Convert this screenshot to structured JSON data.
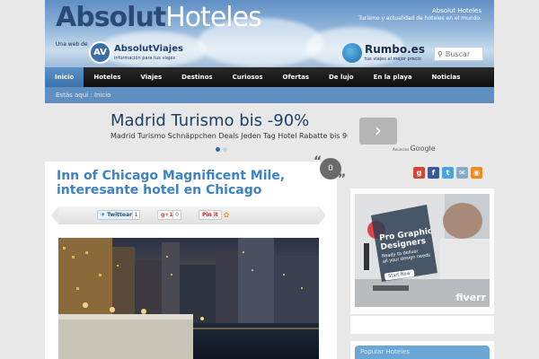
{
  "header": {
    "logo_part1": "Absolut",
    "logo_part2": "Hoteles",
    "una_web": "Una web de",
    "partner_mark": "AV",
    "partner_name": "AbsolutViajes",
    "partner_tagline": "información para tus viajes",
    "site_title": "Absolut Hoteles",
    "site_subtitle": "Turismo y actualidad de hoteles en el mundo.",
    "rumbo_name": "Rumbo.es",
    "rumbo_tagline": "tus viajes al mejor precio",
    "search_placeholder": "Buscar"
  },
  "nav": {
    "items": [
      {
        "label": "Inicio",
        "active": true
      },
      {
        "label": "Hoteles"
      },
      {
        "label": "Viajes"
      },
      {
        "label": "Destinos"
      },
      {
        "label": "Curiosos"
      },
      {
        "label": "Ofertas"
      },
      {
        "label": "De lujo"
      },
      {
        "label": "En la playa"
      },
      {
        "label": "Noticias"
      }
    ]
  },
  "breadcrumb": {
    "text": "Estás aquí : Inicio"
  },
  "ad_banner": {
    "title": "Madrid Turismo bis -90%",
    "text": "Madrid Turismo Schnäppchen Deals Jeden Tag Hotel Rabatte bis 90%!",
    "arrow": "›",
    "google_label": "Anuncios",
    "google_brand": "Google"
  },
  "post": {
    "title": "Inn of Chicago Magnificent Mile, interesante hotel en Chicago",
    "comment_count": "0",
    "quote_open": "“",
    "quote_close": "”",
    "share": {
      "twitter_label": "Twittear",
      "twitter_count": "1",
      "gplus_label": "g+1",
      "gplus_count": "0",
      "pinterest_label": "Pin it",
      "meneame_icon": "meneame-icon"
    }
  },
  "sidebar": {
    "social_icons": [
      {
        "name": "googleplus-icon",
        "glyph": "g",
        "color": "#d34836"
      },
      {
        "name": "facebook-icon",
        "glyph": "f",
        "color": "#3b5998"
      },
      {
        "name": "twitter-icon",
        "glyph": "t",
        "color": "#4aa3df"
      },
      {
        "name": "email-icon",
        "glyph": "✉",
        "color": "#8aa9c4"
      },
      {
        "name": "rss-icon",
        "glyph": "◉",
        "color": "#f08a24"
      }
    ],
    "ad": {
      "headline1": "Pro Graphic",
      "headline2": "Designers",
      "sub1": "Ready to deliver",
      "sub2": "all your design needs",
      "cta": "Start Now",
      "brand": "fiverr"
    },
    "widget_title": "Popular Hoteles"
  },
  "colors": {
    "accent": "#3f82c4",
    "nav_bg": "#111111",
    "breadcrumb_bg": "#5f8ec1",
    "page_bg": "#e8e8e8"
  }
}
